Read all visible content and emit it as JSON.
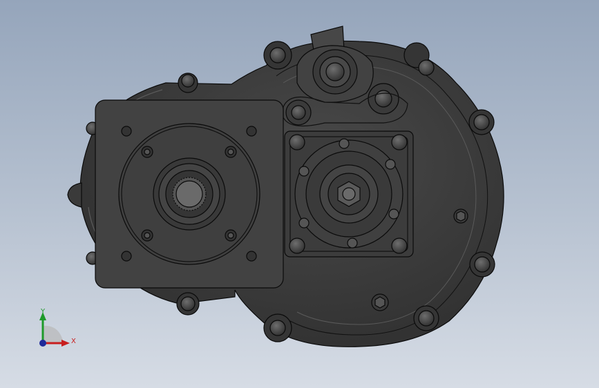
{
  "viewport": {
    "background_top": "#95a5bb",
    "background_bottom": "#d6dce5"
  },
  "model": {
    "body_color": "#3d3d3d",
    "edge_color": "#0a0a0a",
    "highlight_color": "#6a6a6a"
  },
  "triad": {
    "x_label": "X",
    "y_label": "Y",
    "x_color": "#c81e1e",
    "y_color": "#1e9a2a",
    "z_color": "#1e2a9a",
    "x_icon": "x-axis-arrow-icon",
    "y_icon": "y-axis-arrow-icon",
    "z_icon": "z-axis-dot-icon"
  }
}
